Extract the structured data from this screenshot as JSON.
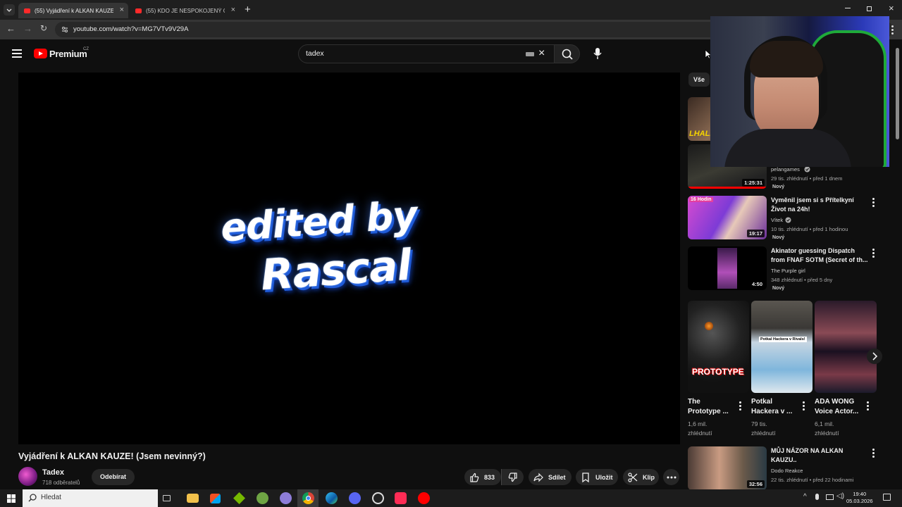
{
  "browser": {
    "tabs": [
      {
        "label": "(55) Vyjádření k ALKAN KAUZE!",
        "active": true
      },
      {
        "label": "(55) KDO JE NESPOKOJENÝ OB",
        "active": false
      }
    ],
    "url": "youtube.com/watch?v=MG7VTv9V29A"
  },
  "header": {
    "logo": "Premium",
    "region": "CZ",
    "search_value": "tadex"
  },
  "video": {
    "overlay_line1": "edited by",
    "overlay_line2": "Rascal",
    "title": "Vyjádření k ALKAN KAUZE! (Jsem nevinný?)",
    "channel": "Tadex",
    "subscribers": "718 odběratelů",
    "subscribe_label": "Odebírat",
    "likes": "833",
    "share_label": "Sdílet",
    "save_label": "Uložit",
    "clip_label": "Klip"
  },
  "sidebar": {
    "chip": "Vše",
    "recommendations": [
      {
        "title_line1": "",
        "title_line2": "",
        "channel": "pelangames",
        "meta": "29 tis. zhlédnutí • před 1 dnem",
        "badge": "Nový",
        "duration": "1:25:31"
      },
      {
        "title_line1": "Vyměnil jsem si s Přítelkyní",
        "title_line2": "Život na 24h!",
        "channel": "Vítek",
        "meta": "10 tis. zhlédnutí • před 1 hodinou",
        "badge": "Nový",
        "duration": "19:17"
      },
      {
        "title_line1": "Akinator guessing Dispatch",
        "title_line2": "from FNAF SOTM (Secret of th...",
        "channel": "The Purple girl",
        "meta": "348 zhlédnutí • před 5 dny",
        "badge": "Nový",
        "duration": "4:50"
      },
      {
        "title_line1": "MŮJ NÁZOR NA ALKAN",
        "title_line2": "KAUZU..",
        "channel": "Dodo Reakce",
        "meta": "22 tis. zhlédnutí • před 22 hodinami",
        "badge": "",
        "duration": "32:56"
      }
    ],
    "shorts": [
      {
        "title_line1": "The",
        "title_line2": "Prototype ...",
        "views_line1": "1,6 mil.",
        "views_line2": "zhlédnutí",
        "thumb_text": "PROTOTYPE"
      },
      {
        "title_line1": "Potkal",
        "title_line2": "Hackera v ...",
        "views_line1": "79 tis.",
        "views_line2": "zhlédnutí",
        "thumb_text": "Potkal Hackera v Rivals!"
      },
      {
        "title_line1": "ADA WONG",
        "title_line2": "Voice Actor...",
        "views_line1": "6,1 mil.",
        "views_line2": "zhlédnutí",
        "thumb_text": ""
      }
    ]
  },
  "taskbar": {
    "search_placeholder": "Hledat",
    "time": "19:40",
    "date": "05.03.2026"
  }
}
